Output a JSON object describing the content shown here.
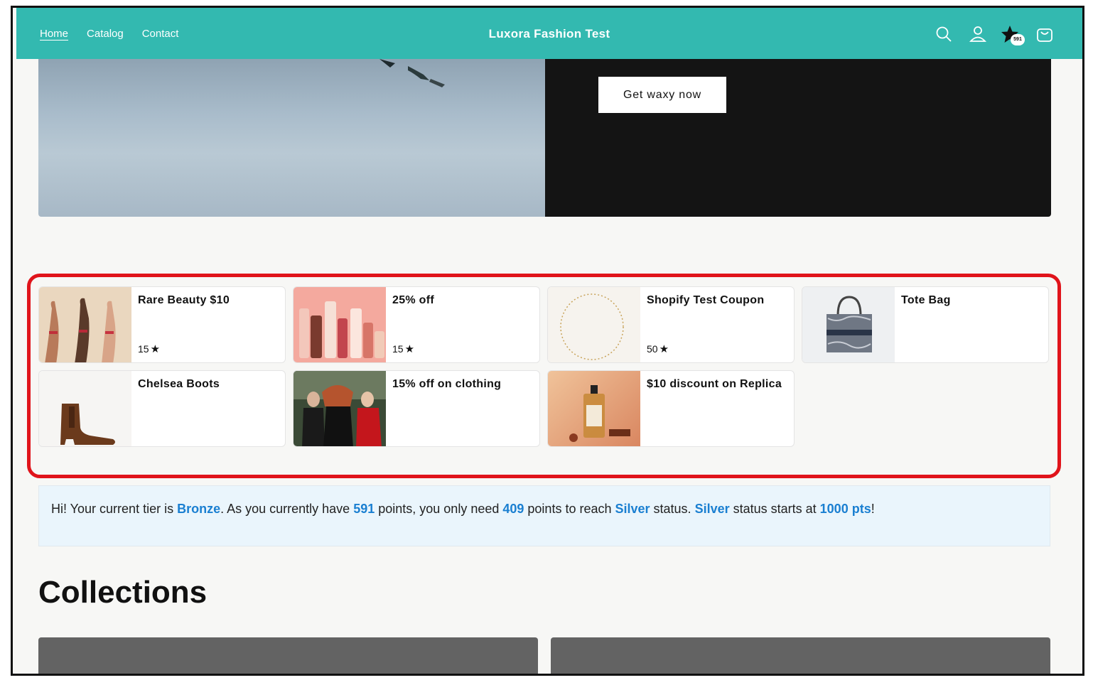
{
  "nav": {
    "home": "Home",
    "catalog": "Catalog",
    "contact": "Contact"
  },
  "brand": "Luxora Fashion Test",
  "header_icons": [
    "search-icon",
    "account-icon",
    "loyalty-star-icon",
    "cart-icon"
  ],
  "points_badge": "591",
  "hero": {
    "cta_label": "Get waxy now"
  },
  "rewards": [
    {
      "title": "Rare Beauty $10",
      "points": "15"
    },
    {
      "title": "25% off",
      "points": "15"
    },
    {
      "title": "Shopify Test Coupon",
      "points": "50"
    },
    {
      "title": "Tote Bag"
    },
    {
      "title": "Chelsea Boots"
    },
    {
      "title": "15% off on clothing"
    },
    {
      "title": "$10 discount on Replica"
    }
  ],
  "tier": {
    "t1": "Hi! Your current tier is ",
    "tier_name": "Bronze",
    "t2": ". As you currently have ",
    "points": "591",
    "t3": " points, you only need ",
    "needed": "409",
    "t4": " points to reach ",
    "next_tier": "Silver",
    "t5": " status. ",
    "next_tier_2": "Silver",
    "t6": " status starts at ",
    "threshold": "1000 pts",
    "t7": "!"
  },
  "collections_title": "Collections",
  "colors": {
    "header": "#33b9b0",
    "highlight": "#e0141b",
    "tier_accent": "#1a7fd1"
  }
}
